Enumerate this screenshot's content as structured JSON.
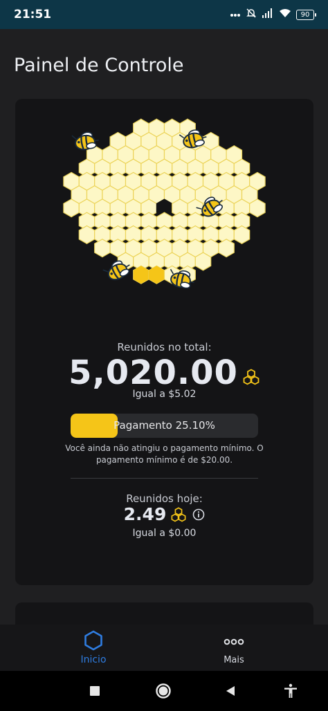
{
  "status_bar": {
    "time": "21:51",
    "battery": "90",
    "icons": [
      "more-dots-icon",
      "alarm-off-icon",
      "signal-icon",
      "wifi-icon",
      "battery-icon"
    ]
  },
  "page": {
    "title": "Painel de Controle"
  },
  "dashboard": {
    "total_label": "Reunidos no total:",
    "total_value": "5,020.00",
    "total_equal": "Igual a $5.02",
    "payment_label": "Pagamento 25.10%",
    "payment_progress": 0.251,
    "min_notice": "Você ainda não atingiu o pagamento mínimo. O pagamento mínimo é de $20.00.",
    "today_label": "Reunidos hoje:",
    "today_value": "2.49",
    "today_equal": "Igual a $0.00"
  },
  "nav": {
    "home_label": "Inicio",
    "more_label": "Mais"
  },
  "colors": {
    "accent": "#2f7de1",
    "honey": "#f5c518",
    "comb": "#fdf7c6",
    "comb_stroke": "#ecd45a",
    "status_bar": "#0d3647",
    "background": "#1f1f21",
    "card": "#141416"
  }
}
